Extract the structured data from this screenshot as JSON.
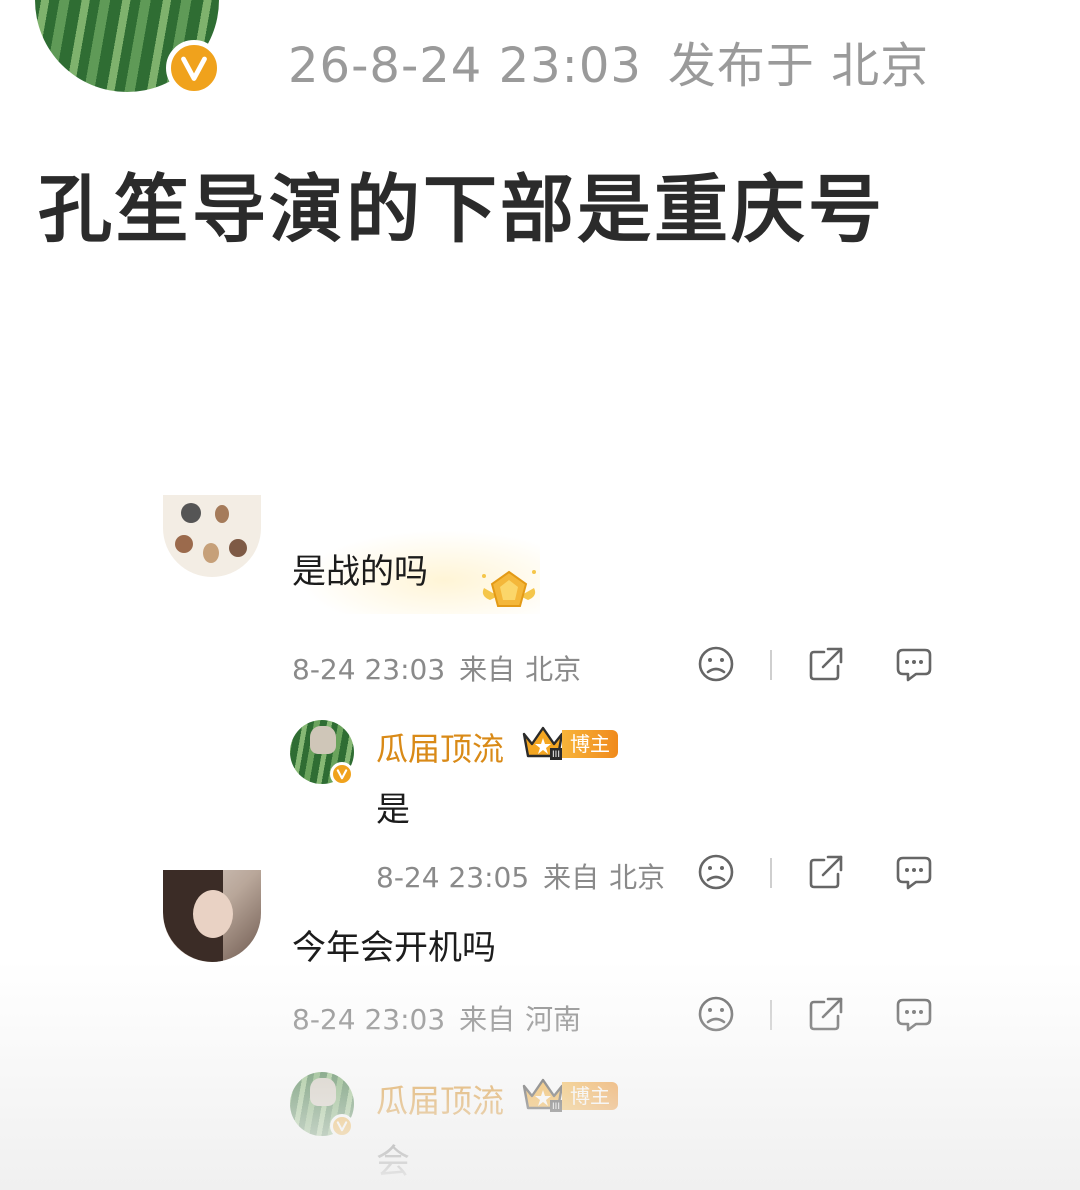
{
  "post": {
    "date": "26-8-24 23:03",
    "published_location": "发布于 北京",
    "title": "孔笙导演的下部是重庆号"
  },
  "comments": [
    {
      "text": "是战的吗",
      "date": "8-24 23:03",
      "from_label": "来自",
      "location": "北京",
      "reply": {
        "author": "瓜届顶流",
        "badge": "博主",
        "text": "是",
        "date": "8-24 23:05",
        "from_label": "来自",
        "location": "北京"
      }
    },
    {
      "text": "今年会开机吗",
      "date": "8-24 23:03",
      "from_label": "来自",
      "location": "河南",
      "reply": {
        "author": "瓜届顶流",
        "badge": "博主",
        "text": "会"
      }
    }
  ],
  "icons": [
    "dislike-icon",
    "share-icon",
    "comment-icon",
    "vip-badge-icon",
    "crown-icon",
    "gold-medal-icon"
  ],
  "colors": {
    "author_name": "#d98a17",
    "badge_orange": "#f08a1c",
    "vip_badge": "#f0a21c",
    "meta_gray": "#8a8a8a"
  }
}
